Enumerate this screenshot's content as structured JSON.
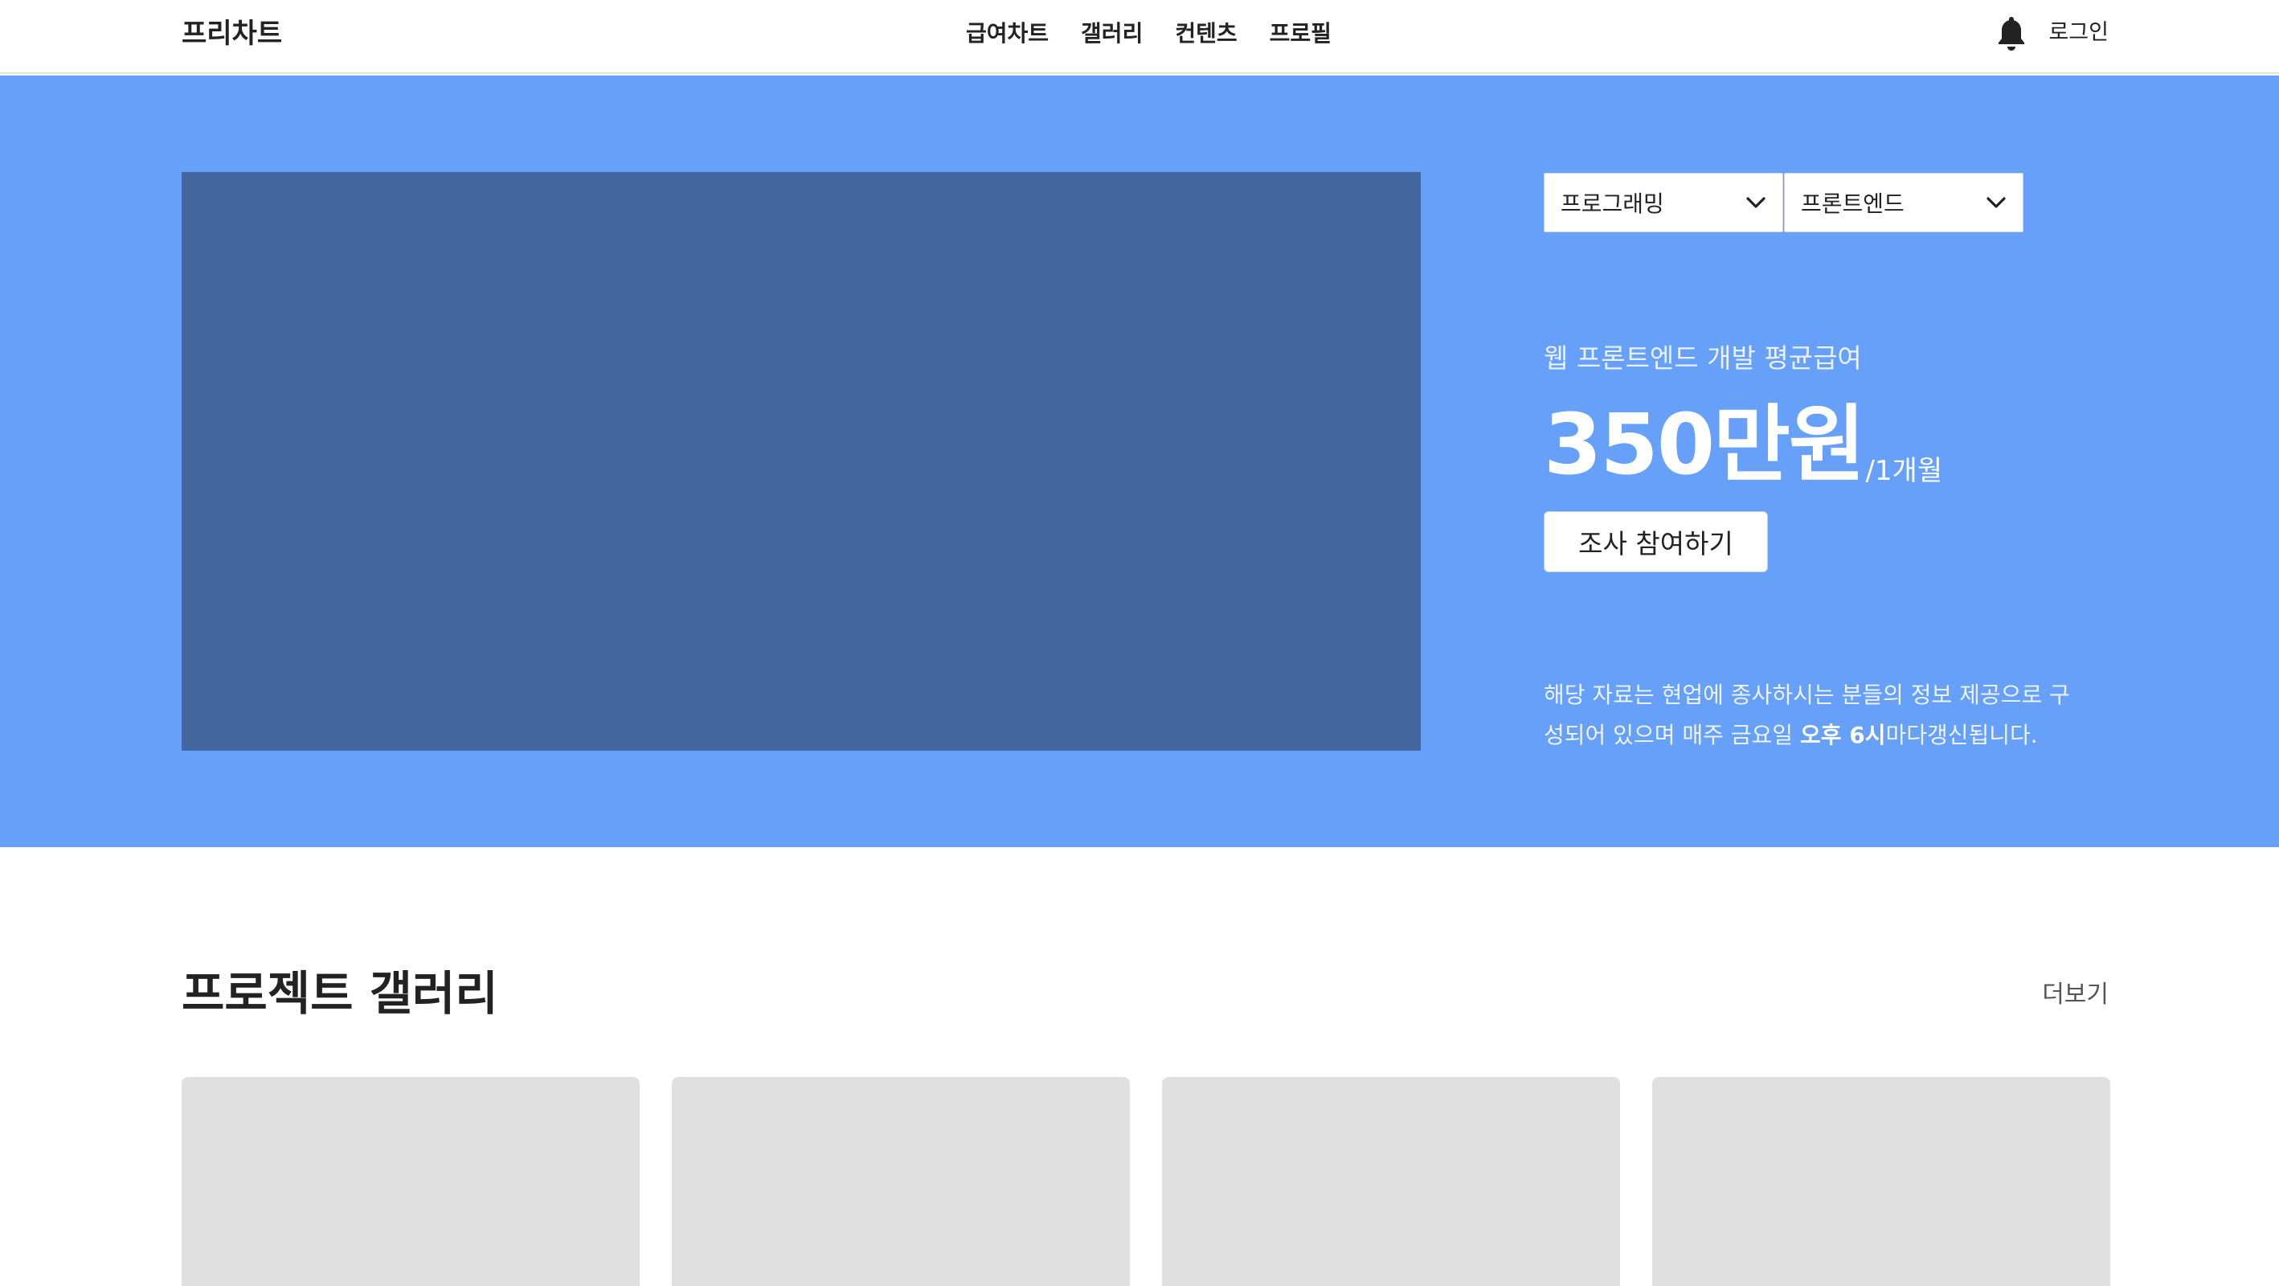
{
  "header": {
    "logo": "프리차트",
    "nav": [
      {
        "label": "급여차트"
      },
      {
        "label": "갤러리"
      },
      {
        "label": "컨텐츠"
      },
      {
        "label": "프로필"
      }
    ],
    "login_label": "로그인",
    "icon": "bell-icon"
  },
  "hero": {
    "background_color": "#66a0f8",
    "media_color": "#44679f",
    "selects": [
      {
        "value": "프로그래밍",
        "icon": "chevron-down-icon"
      },
      {
        "value": "프론트엔드",
        "icon": "chevron-down-icon"
      }
    ],
    "caption": "웹 프론트엔드 개발 평균급여",
    "amount": "350만원",
    "unit": "/1개월",
    "button_label": "조사 참여하기",
    "notice_before": "해당 자료는 현업에 종사하시는 분들의 정보 제공으로 구성되어 있으며 매주 금요일 ",
    "notice_bold": "오후 6시",
    "notice_after": "마다갱신됩니다."
  },
  "gallery": {
    "title": "프로젝트 갤러리",
    "more_label": "더보기",
    "card_color": "#e0e0e0"
  }
}
